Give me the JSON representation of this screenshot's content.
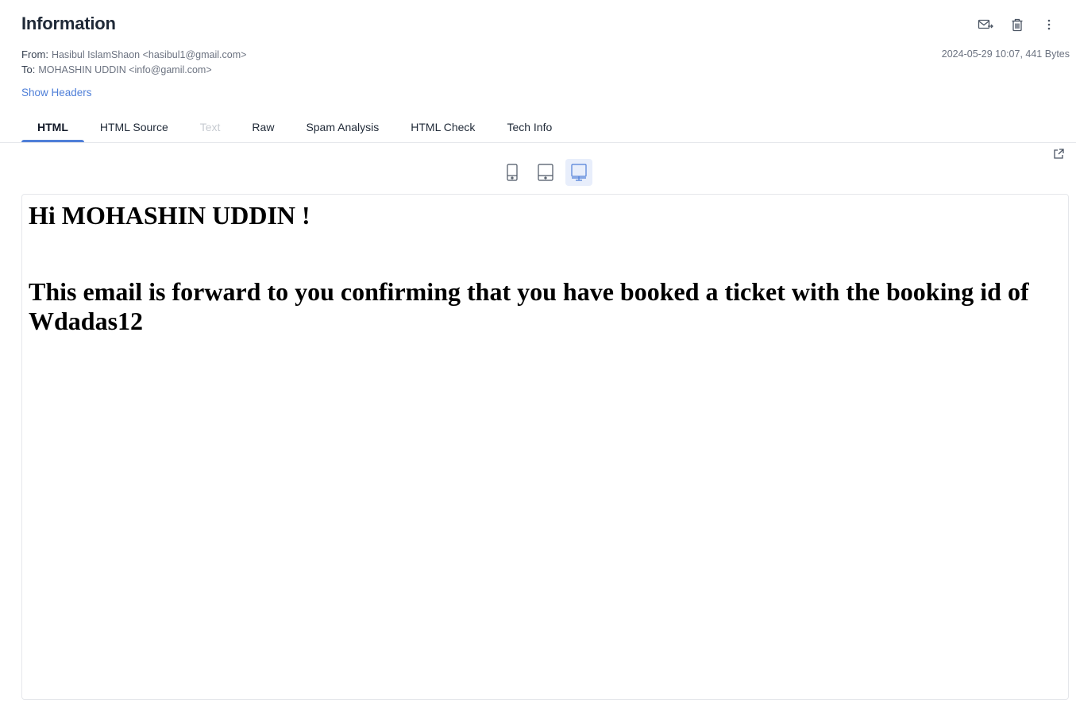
{
  "message": {
    "subject": "Information",
    "from_label": "From:",
    "from_value": "Hasibul IslamShaon <hasibul1@gmail.com>",
    "to_label": "To:",
    "to_value": "MOHASHIN UDDIN <info@gamil.com>",
    "date_size": "2024-05-29 10:07, 441 Bytes",
    "show_headers": "Show Headers"
  },
  "actions": [
    {
      "icon": "forward-mail-icon"
    },
    {
      "icon": "trash-icon"
    },
    {
      "icon": "more-vertical-icon"
    }
  ],
  "tabs": [
    {
      "label": "HTML",
      "state": "active"
    },
    {
      "label": "HTML Source",
      "state": "normal"
    },
    {
      "label": "Text",
      "state": "disabled"
    },
    {
      "label": "Raw",
      "state": "normal"
    },
    {
      "label": "Spam Analysis",
      "state": "normal"
    },
    {
      "label": "HTML Check",
      "state": "normal"
    },
    {
      "label": "Tech Info",
      "state": "normal"
    }
  ],
  "devices": [
    {
      "icon": "mobile-icon",
      "selected": false
    },
    {
      "icon": "tablet-icon",
      "selected": false
    },
    {
      "icon": "desktop-icon",
      "selected": true
    }
  ],
  "preview": {
    "greeting": "Hi MOHASHIN UDDIN !",
    "body": "This email is forward to you confirming that you have booked a ticket with the booking id of Wdadas12"
  },
  "colors": {
    "accent": "#4f7fd8",
    "selected_bg": "#e8eefb",
    "muted_text": "#6b7280",
    "disabled_tab": "#c7cbd1"
  }
}
